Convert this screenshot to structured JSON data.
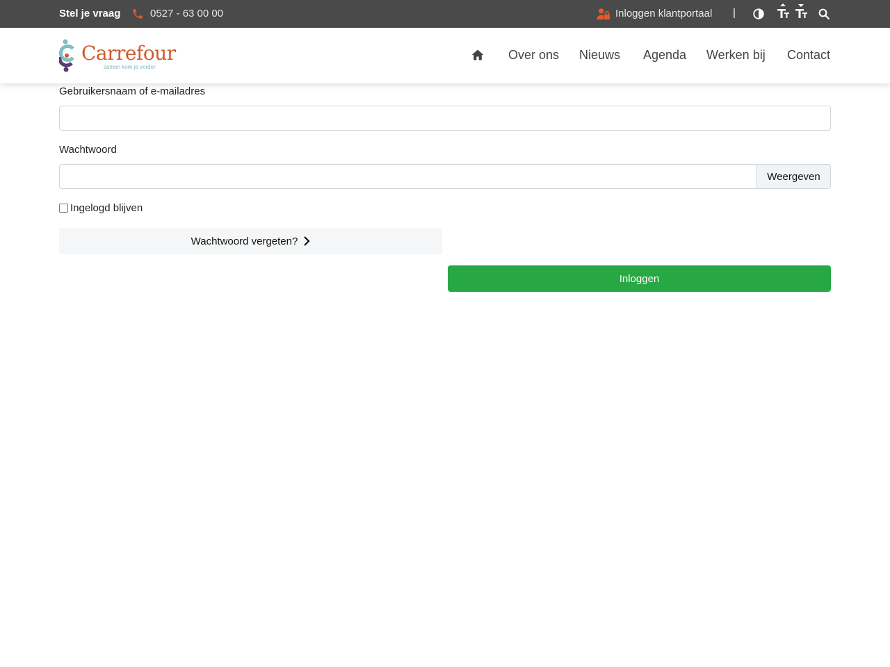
{
  "topbar": {
    "ask_label": "Stel je vraag",
    "phone": "0527 - 63 00 00",
    "portal_label": "Inloggen klantportaal",
    "separator": "|",
    "icons": [
      "phone-icon",
      "user-lock-icon",
      "contrast-icon",
      "font-increase-icon",
      "font-decrease-icon",
      "search-icon"
    ]
  },
  "header": {
    "logo_text": "Carrefour",
    "logo_tagline": "samen kom je verder",
    "nav": [
      "Over ons",
      "Nieuws",
      "Agenda",
      "Werken bij",
      "Contact"
    ],
    "home_icon": "home-icon"
  },
  "form": {
    "username_label": "Gebruikersnaam of e-mailadres",
    "username_value": "",
    "password_label": "Wachtwoord",
    "password_value": "",
    "show_label": "Weergeven",
    "remember_label": "Ingelogd blijven",
    "remember_checked": false,
    "forgot_label": "Wachtwoord vergeten?",
    "login_label": "Inloggen"
  },
  "colors": {
    "topbar_bg": "#4a4a4a",
    "accent_orange": "#d05a2c",
    "login_green": "#28a745"
  }
}
